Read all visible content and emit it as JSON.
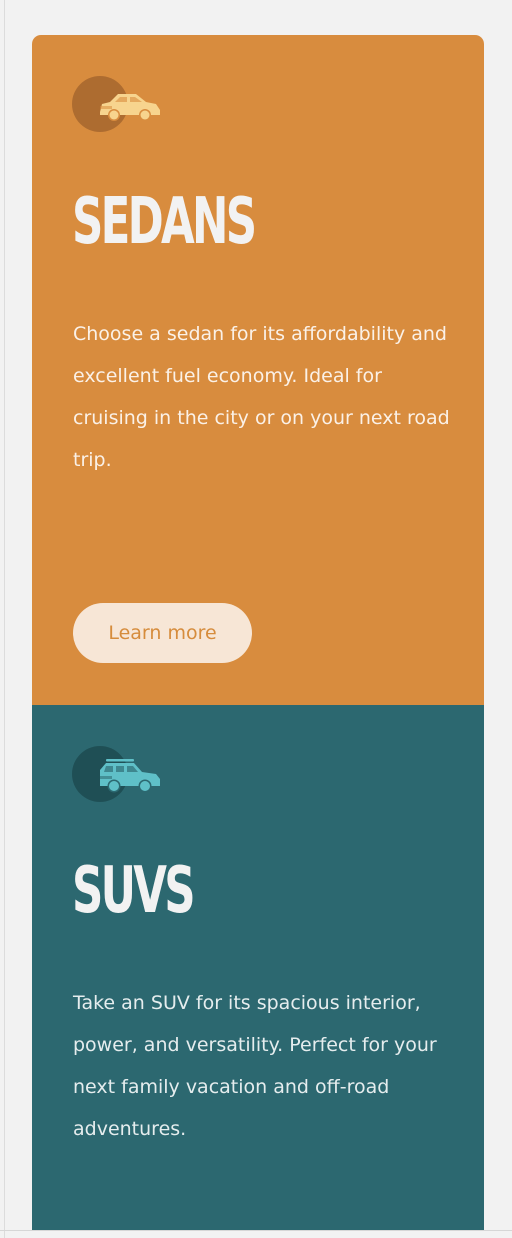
{
  "cards": [
    {
      "title": "SEDANS",
      "description": "Choose a sedan for its affordability and excellent fuel economy. Ideal for cruising in the city or on your next road trip.",
      "button_label": "Learn more",
      "icon": "sedan-car-icon",
      "background_color": "#d88c3e",
      "icon_circle_color": "#a8682f",
      "icon_color": "#f7d48e"
    },
    {
      "title": "SUVS",
      "description": "Take an SUV for its spacious interior, power, and versatility. Perfect for your next family vacation and off-road adventures.",
      "icon": "suv-car-icon",
      "background_color": "#2c6870",
      "icon_circle_color": "#1e4c52",
      "icon_color": "#5fc0c8"
    }
  ],
  "colors": {
    "page_background": "#f2f2f2",
    "title_text": "#f2f2f2",
    "button_background": "#f7e6d6",
    "button_text": "#d68c3c"
  }
}
